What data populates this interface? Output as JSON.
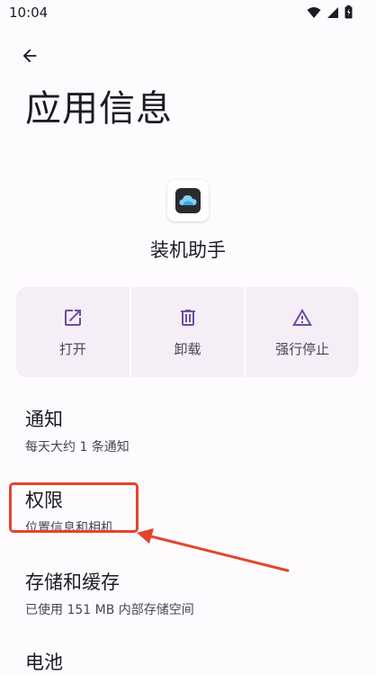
{
  "status_bar": {
    "time": "10:04",
    "icons": [
      "wifi-icon",
      "signal-icon",
      "battery-icon"
    ]
  },
  "header": {
    "back_icon": "arrow-back-icon",
    "title": "应用信息"
  },
  "app": {
    "icon": "cloud-app-icon",
    "name": "装机助手"
  },
  "actions": [
    {
      "icon": "open-icon",
      "label": "打开"
    },
    {
      "icon": "delete-icon",
      "label": "卸载"
    },
    {
      "icon": "warning-icon",
      "label": "强行停止"
    }
  ],
  "settings": [
    {
      "title": "通知",
      "subtitle": "每天大约 1 条通知"
    },
    {
      "title": "权限",
      "subtitle": "位置信息和相机"
    },
    {
      "title": "存储和缓存",
      "subtitle": "已使用 151 MB 内部存储空间"
    },
    {
      "title": "电池",
      "subtitle": ""
    }
  ],
  "annotation": {
    "color": "#e4442f",
    "target": "权限"
  },
  "colors": {
    "background": "#fefbff",
    "action_bg": "#f6eef6",
    "accent": "#6750a4"
  }
}
